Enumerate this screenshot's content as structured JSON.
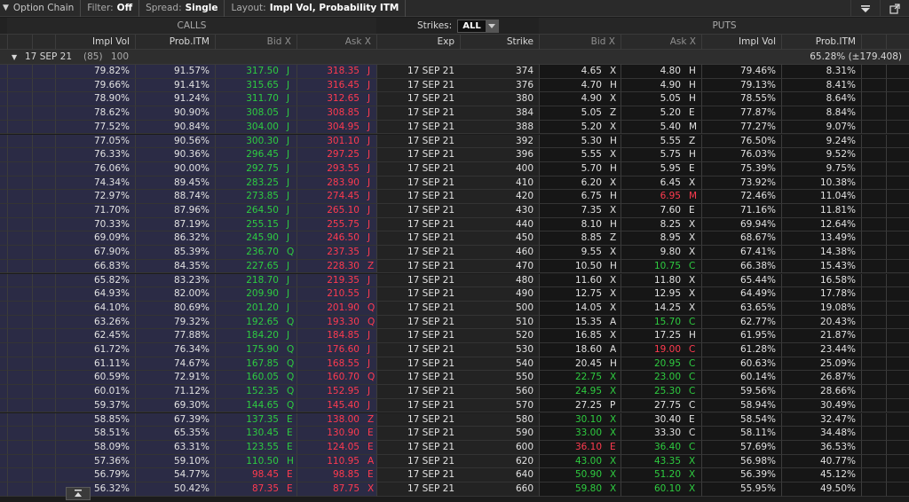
{
  "toolbar": {
    "title": "Option Chain",
    "filter_label": "Filter:",
    "filter_value": "Off",
    "spread_label": "Spread:",
    "spread_value": "Single",
    "layout_label": "Layout:",
    "layout_value": "Impl Vol, Probability ITM"
  },
  "section": {
    "calls": "CALLS",
    "puts": "PUTS",
    "strikes_label": "Strikes:",
    "strikes_value": "ALL"
  },
  "columns": {
    "call_iv": "Impl Vol",
    "call_prob": "Prob.ITM",
    "call_bid": "Bid X",
    "call_ask": "Ask X",
    "exp": "Exp",
    "strike": "Strike",
    "put_bid": "Bid X",
    "put_ask": "Ask X",
    "put_iv": "Impl Vol",
    "put_prob": "Prob.ITM"
  },
  "group": {
    "expiry": "17 SEP 21",
    "days": "(85)",
    "multiplier": "100",
    "iv_summary": "65.28% (±179.408)"
  },
  "colors": {
    "up": "#2ecc40",
    "down": "#ff3b4f",
    "call_bg": "#2b2b45"
  },
  "rows": [
    {
      "civ": "79.82%",
      "cprob": "91.57%",
      "cbid": "317.50",
      "cbx": "J",
      "cask": "318.35",
      "cax": "J",
      "exp": "17 SEP 21",
      "strike": "374",
      "pbid": "4.65",
      "pbx": "X",
      "pask": "4.80",
      "pax": "H",
      "piv": "79.46%",
      "pprob": "8.31%",
      "cbc": "g",
      "cac": "r",
      "pbc": "w",
      "pac": "w"
    },
    {
      "civ": "79.66%",
      "cprob": "91.41%",
      "cbid": "315.65",
      "cbx": "J",
      "cask": "316.45",
      "cax": "J",
      "exp": "17 SEP 21",
      "strike": "376",
      "pbid": "4.70",
      "pbx": "H",
      "pask": "4.90",
      "pax": "H",
      "piv": "79.13%",
      "pprob": "8.41%",
      "cbc": "g",
      "cac": "r",
      "pbc": "w",
      "pac": "w"
    },
    {
      "civ": "78.90%",
      "cprob": "91.24%",
      "cbid": "311.70",
      "cbx": "J",
      "cask": "312.65",
      "cax": "J",
      "exp": "17 SEP 21",
      "strike": "380",
      "pbid": "4.90",
      "pbx": "X",
      "pask": "5.05",
      "pax": "H",
      "piv": "78.55%",
      "pprob": "8.64%",
      "cbc": "g",
      "cac": "r",
      "pbc": "w",
      "pac": "w"
    },
    {
      "civ": "78.62%",
      "cprob": "90.90%",
      "cbid": "308.05",
      "cbx": "J",
      "cask": "308.85",
      "cax": "J",
      "exp": "17 SEP 21",
      "strike": "384",
      "pbid": "5.05",
      "pbx": "Z",
      "pask": "5.20",
      "pax": "E",
      "piv": "77.87%",
      "pprob": "8.84%",
      "cbc": "g",
      "cac": "r",
      "pbc": "w",
      "pac": "w"
    },
    {
      "civ": "77.52%",
      "cprob": "90.84%",
      "cbid": "304.00",
      "cbx": "J",
      "cask": "304.95",
      "cax": "J",
      "exp": "17 SEP 21",
      "strike": "388",
      "pbid": "5.20",
      "pbx": "X",
      "pask": "5.40",
      "pax": "M",
      "piv": "77.27%",
      "pprob": "9.07%",
      "cbc": "g",
      "cac": "r",
      "pbc": "w",
      "pac": "w"
    },
    {
      "civ": "77.05%",
      "cprob": "90.56%",
      "cbid": "300.30",
      "cbx": "J",
      "cask": "301.10",
      "cax": "J",
      "exp": "17 SEP 21",
      "strike": "392",
      "pbid": "5.30",
      "pbx": "H",
      "pask": "5.55",
      "pax": "Z",
      "piv": "76.50%",
      "pprob": "9.24%",
      "cbc": "g",
      "cac": "r",
      "pbc": "w",
      "pac": "w"
    },
    {
      "civ": "76.33%",
      "cprob": "90.36%",
      "cbid": "296.45",
      "cbx": "J",
      "cask": "297.25",
      "cax": "J",
      "exp": "17 SEP 21",
      "strike": "396",
      "pbid": "5.55",
      "pbx": "X",
      "pask": "5.75",
      "pax": "H",
      "piv": "76.03%",
      "pprob": "9.52%",
      "cbc": "g",
      "cac": "r",
      "pbc": "w",
      "pac": "w"
    },
    {
      "civ": "76.06%",
      "cprob": "90.00%",
      "cbid": "292.75",
      "cbx": "J",
      "cask": "293.55",
      "cax": "J",
      "exp": "17 SEP 21",
      "strike": "400",
      "pbid": "5.70",
      "pbx": "H",
      "pask": "5.95",
      "pax": "E",
      "piv": "75.39%",
      "pprob": "9.75%",
      "cbc": "g",
      "cac": "r",
      "pbc": "w",
      "pac": "w"
    },
    {
      "civ": "74.34%",
      "cprob": "89.45%",
      "cbid": "283.25",
      "cbx": "J",
      "cask": "283.90",
      "cax": "J",
      "exp": "17 SEP 21",
      "strike": "410",
      "pbid": "6.20",
      "pbx": "X",
      "pask": "6.45",
      "pax": "X",
      "piv": "73.92%",
      "pprob": "10.38%",
      "cbc": "g",
      "cac": "r",
      "pbc": "w",
      "pac": "w"
    },
    {
      "civ": "72.97%",
      "cprob": "88.74%",
      "cbid": "273.85",
      "cbx": "J",
      "cask": "274.45",
      "cax": "J",
      "exp": "17 SEP 21",
      "strike": "420",
      "pbid": "6.75",
      "pbx": "H",
      "pask": "6.95",
      "pax": "M",
      "piv": "72.46%",
      "pprob": "11.04%",
      "cbc": "g",
      "cac": "r",
      "pbc": "w",
      "pac": "r"
    },
    {
      "civ": "71.70%",
      "cprob": "87.96%",
      "cbid": "264.50",
      "cbx": "J",
      "cask": "265.10",
      "cax": "J",
      "exp": "17 SEP 21",
      "strike": "430",
      "pbid": "7.35",
      "pbx": "X",
      "pask": "7.60",
      "pax": "E",
      "piv": "71.16%",
      "pprob": "11.81%",
      "cbc": "g",
      "cac": "r",
      "pbc": "w",
      "pac": "w"
    },
    {
      "civ": "70.33%",
      "cprob": "87.19%",
      "cbid": "255.15",
      "cbx": "J",
      "cask": "255.75",
      "cax": "J",
      "exp": "17 SEP 21",
      "strike": "440",
      "pbid": "8.10",
      "pbx": "H",
      "pask": "8.25",
      "pax": "X",
      "piv": "69.94%",
      "pprob": "12.64%",
      "cbc": "g",
      "cac": "r",
      "pbc": "w",
      "pac": "w"
    },
    {
      "civ": "69.09%",
      "cprob": "86.32%",
      "cbid": "245.90",
      "cbx": "J",
      "cask": "246.50",
      "cax": "J",
      "exp": "17 SEP 21",
      "strike": "450",
      "pbid": "8.85",
      "pbx": "Z",
      "pask": "8.95",
      "pax": "X",
      "piv": "68.67%",
      "pprob": "13.49%",
      "cbc": "g",
      "cac": "r",
      "pbc": "w",
      "pac": "w"
    },
    {
      "civ": "67.90%",
      "cprob": "85.39%",
      "cbid": "236.70",
      "cbx": "Q",
      "cask": "237.35",
      "cax": "J",
      "exp": "17 SEP 21",
      "strike": "460",
      "pbid": "9.55",
      "pbx": "X",
      "pask": "9.80",
      "pax": "X",
      "piv": "67.41%",
      "pprob": "14.38%",
      "cbc": "g",
      "cac": "r",
      "pbc": "w",
      "pac": "w"
    },
    {
      "civ": "66.83%",
      "cprob": "84.35%",
      "cbid": "227.65",
      "cbx": "J",
      "cask": "228.30",
      "cax": "Z",
      "exp": "17 SEP 21",
      "strike": "470",
      "pbid": "10.50",
      "pbx": "H",
      "pask": "10.75",
      "pax": "C",
      "piv": "66.38%",
      "pprob": "15.43%",
      "cbc": "g",
      "cac": "r",
      "pbc": "w",
      "pac": "g"
    },
    {
      "civ": "65.82%",
      "cprob": "83.23%",
      "cbid": "218.70",
      "cbx": "J",
      "cask": "219.35",
      "cax": "J",
      "exp": "17 SEP 21",
      "strike": "480",
      "pbid": "11.60",
      "pbx": "X",
      "pask": "11.80",
      "pax": "X",
      "piv": "65.44%",
      "pprob": "16.58%",
      "cbc": "g",
      "cac": "r",
      "pbc": "w",
      "pac": "w"
    },
    {
      "civ": "64.93%",
      "cprob": "82.00%",
      "cbid": "209.90",
      "cbx": "J",
      "cask": "210.55",
      "cax": "J",
      "exp": "17 SEP 21",
      "strike": "490",
      "pbid": "12.75",
      "pbx": "X",
      "pask": "12.95",
      "pax": "X",
      "piv": "64.49%",
      "pprob": "17.78%",
      "cbc": "g",
      "cac": "r",
      "pbc": "w",
      "pac": "w"
    },
    {
      "civ": "64.10%",
      "cprob": "80.69%",
      "cbid": "201.20",
      "cbx": "J",
      "cask": "201.90",
      "cax": "Q",
      "exp": "17 SEP 21",
      "strike": "500",
      "pbid": "14.05",
      "pbx": "X",
      "pask": "14.25",
      "pax": "X",
      "piv": "63.65%",
      "pprob": "19.08%",
      "cbc": "g",
      "cac": "r",
      "pbc": "w",
      "pac": "w"
    },
    {
      "civ": "63.26%",
      "cprob": "79.32%",
      "cbid": "192.65",
      "cbx": "Q",
      "cask": "193.30",
      "cax": "Q",
      "exp": "17 SEP 21",
      "strike": "510",
      "pbid": "15.35",
      "pbx": "A",
      "pask": "15.70",
      "pax": "C",
      "piv": "62.77%",
      "pprob": "20.43%",
      "cbc": "g",
      "cac": "r",
      "pbc": "w",
      "pac": "g"
    },
    {
      "civ": "62.45%",
      "cprob": "77.88%",
      "cbid": "184.20",
      "cbx": "J",
      "cask": "184.85",
      "cax": "J",
      "exp": "17 SEP 21",
      "strike": "520",
      "pbid": "16.85",
      "pbx": "X",
      "pask": "17.25",
      "pax": "H",
      "piv": "61.95%",
      "pprob": "21.87%",
      "cbc": "g",
      "cac": "r",
      "pbc": "w",
      "pac": "w"
    },
    {
      "civ": "61.72%",
      "cprob": "76.34%",
      "cbid": "175.90",
      "cbx": "Q",
      "cask": "176.60",
      "cax": "J",
      "exp": "17 SEP 21",
      "strike": "530",
      "pbid": "18.60",
      "pbx": "A",
      "pask": "19.00",
      "pax": "C",
      "piv": "61.28%",
      "pprob": "23.44%",
      "cbc": "g",
      "cac": "r",
      "pbc": "w",
      "pac": "r"
    },
    {
      "civ": "61.11%",
      "cprob": "74.67%",
      "cbid": "167.85",
      "cbx": "Q",
      "cask": "168.55",
      "cax": "J",
      "exp": "17 SEP 21",
      "strike": "540",
      "pbid": "20.45",
      "pbx": "H",
      "pask": "20.95",
      "pax": "C",
      "piv": "60.63%",
      "pprob": "25.09%",
      "cbc": "g",
      "cac": "r",
      "pbc": "w",
      "pac": "g"
    },
    {
      "civ": "60.59%",
      "cprob": "72.91%",
      "cbid": "160.05",
      "cbx": "Q",
      "cask": "160.70",
      "cax": "Q",
      "exp": "17 SEP 21",
      "strike": "550",
      "pbid": "22.75",
      "pbx": "X",
      "pask": "23.00",
      "pax": "C",
      "piv": "60.14%",
      "pprob": "26.87%",
      "cbc": "g",
      "cac": "r",
      "pbc": "g",
      "pac": "g"
    },
    {
      "civ": "60.01%",
      "cprob": "71.12%",
      "cbid": "152.35",
      "cbx": "Q",
      "cask": "152.95",
      "cax": "J",
      "exp": "17 SEP 21",
      "strike": "560",
      "pbid": "24.95",
      "pbx": "X",
      "pask": "25.30",
      "pax": "C",
      "piv": "59.56%",
      "pprob": "28.66%",
      "cbc": "g",
      "cac": "r",
      "pbc": "g",
      "pac": "g"
    },
    {
      "civ": "59.37%",
      "cprob": "69.30%",
      "cbid": "144.65",
      "cbx": "Q",
      "cask": "145.40",
      "cax": "J",
      "exp": "17 SEP 21",
      "strike": "570",
      "pbid": "27.25",
      "pbx": "P",
      "pask": "27.75",
      "pax": "C",
      "piv": "58.94%",
      "pprob": "30.49%",
      "cbc": "g",
      "cac": "r",
      "pbc": "w",
      "pac": "w"
    },
    {
      "civ": "58.85%",
      "cprob": "67.39%",
      "cbid": "137.35",
      "cbx": "E",
      "cask": "138.00",
      "cax": "Z",
      "exp": "17 SEP 21",
      "strike": "580",
      "pbid": "30.10",
      "pbx": "X",
      "pask": "30.40",
      "pax": "E",
      "piv": "58.54%",
      "pprob": "32.47%",
      "cbc": "g",
      "cac": "r",
      "pbc": "g",
      "pac": "w"
    },
    {
      "civ": "58.51%",
      "cprob": "65.35%",
      "cbid": "130.45",
      "cbx": "E",
      "cask": "130.90",
      "cax": "E",
      "exp": "17 SEP 21",
      "strike": "590",
      "pbid": "33.00",
      "pbx": "X",
      "pask": "33.30",
      "pax": "C",
      "piv": "58.11%",
      "pprob": "34.48%",
      "cbc": "g",
      "cac": "r",
      "pbc": "g",
      "pac": "w"
    },
    {
      "civ": "58.09%",
      "cprob": "63.31%",
      "cbid": "123.55",
      "cbx": "E",
      "cask": "124.05",
      "cax": "E",
      "exp": "17 SEP 21",
      "strike": "600",
      "pbid": "36.10",
      "pbx": "E",
      "pask": "36.40",
      "pax": "C",
      "piv": "57.69%",
      "pprob": "36.53%",
      "cbc": "g",
      "cac": "r",
      "pbc": "r",
      "pac": "g"
    },
    {
      "civ": "57.36%",
      "cprob": "59.10%",
      "cbid": "110.50",
      "cbx": "H",
      "cask": "110.95",
      "cax": "A",
      "exp": "17 SEP 21",
      "strike": "620",
      "pbid": "43.00",
      "pbx": "X",
      "pask": "43.35",
      "pax": "X",
      "piv": "56.98%",
      "pprob": "40.77%",
      "cbc": "g",
      "cac": "r",
      "pbc": "g",
      "pac": "g"
    },
    {
      "civ": "56.79%",
      "cprob": "54.77%",
      "cbid": "98.45",
      "cbx": "E",
      "cask": "98.85",
      "cax": "E",
      "exp": "17 SEP 21",
      "strike": "640",
      "pbid": "50.90",
      "pbx": "X",
      "pask": "51.20",
      "pax": "X",
      "piv": "56.39%",
      "pprob": "45.12%",
      "cbc": "r",
      "cac": "r",
      "pbc": "g",
      "pac": "g"
    },
    {
      "civ": "56.32%",
      "cprob": "50.42%",
      "cbid": "87.35",
      "cbx": "E",
      "cask": "87.75",
      "cax": "X",
      "exp": "17 SEP 21",
      "strike": "660",
      "pbid": "59.80",
      "pbx": "X",
      "pask": "60.10",
      "pax": "X",
      "piv": "55.95%",
      "pprob": "49.50%",
      "cbc": "r",
      "cac": "r",
      "pbc": "g",
      "pac": "g"
    }
  ]
}
